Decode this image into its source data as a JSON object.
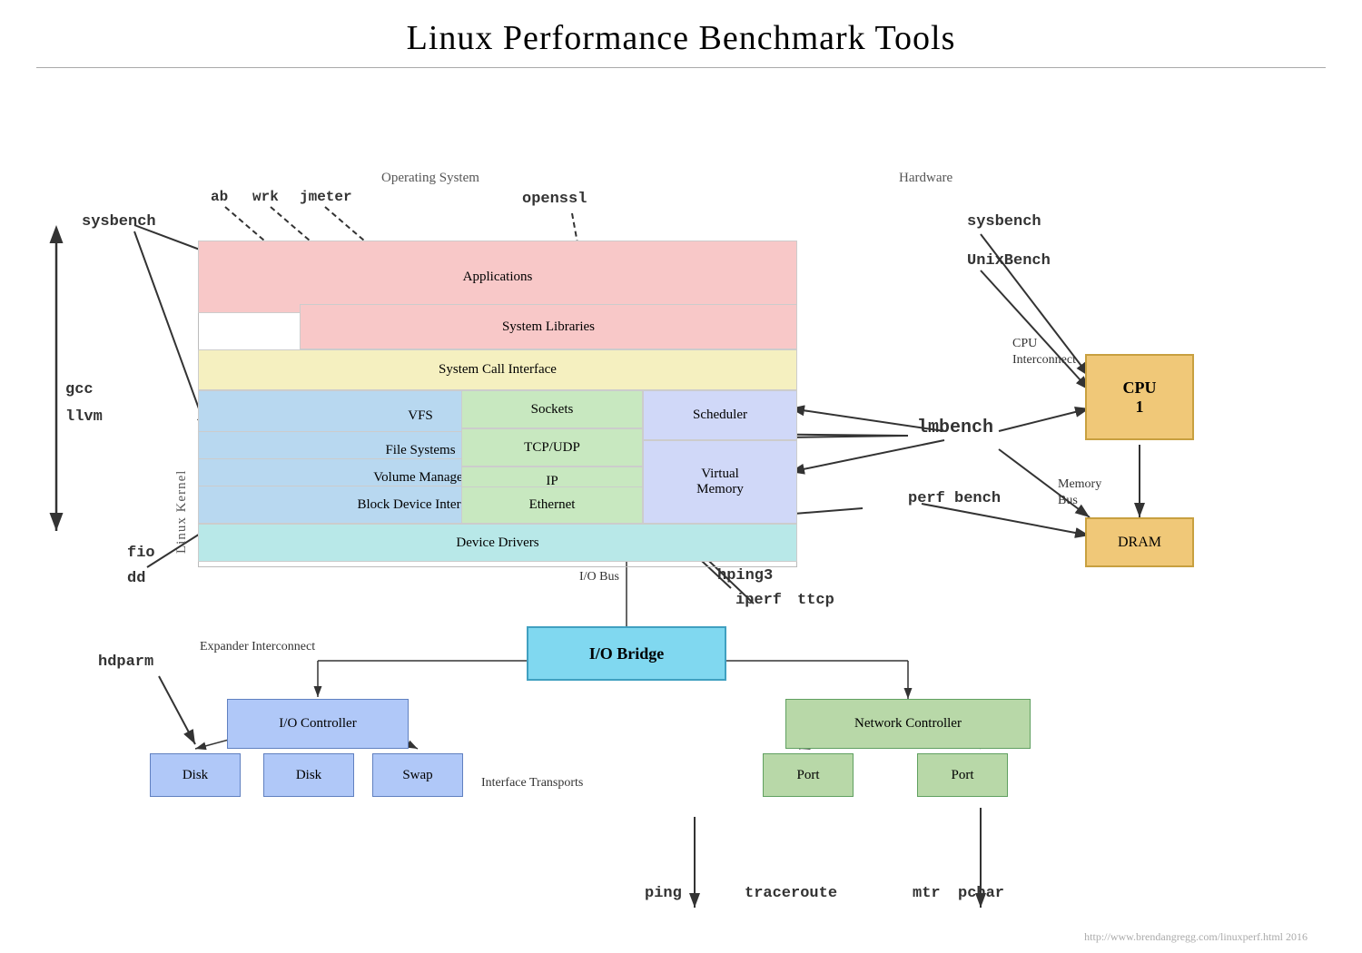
{
  "title": "Linux Performance Benchmark Tools",
  "url": "http://www.brendangregg.com/linuxperf.html 2016",
  "sections": {
    "os_label": "Operating System",
    "hw_label": "Hardware",
    "kernel_label": "Linux Kernel",
    "cpu_interconnect": "CPU\nInterconnect",
    "memory_bus": "Memory\nBus",
    "io_bus": "I/O Bus",
    "expander_interconnect": "Expander Interconnect",
    "interface_transports": "Interface Transports"
  },
  "layers": {
    "applications": "Applications",
    "system_libraries": "System Libraries",
    "system_call_interface": "System Call Interface",
    "vfs": "VFS",
    "file_systems": "File Systems",
    "volume_manager": "Volume Manager",
    "block_device_interface": "Block Device Interface",
    "sockets": "Sockets",
    "tcp_udp": "TCP/UDP",
    "ip": "IP",
    "ethernet": "Ethernet",
    "scheduler": "Scheduler",
    "virtual_memory": "Virtual\nMemory",
    "device_drivers": "Device Drivers"
  },
  "hardware": {
    "cpu": "CPU\n1",
    "dram": "DRAM",
    "io_bridge": "I/O Bridge",
    "io_controller": "I/O Controller",
    "disk1": "Disk",
    "disk2": "Disk",
    "swap": "Swap",
    "network_controller": "Network Controller",
    "port1": "Port",
    "port2": "Port"
  },
  "tools": {
    "sysbench_left": "sysbench",
    "ab": "ab",
    "wrk": "wrk",
    "jmeter": "jmeter",
    "openssl": "openssl",
    "gcc": "gcc",
    "llvm": "llvm",
    "fio": "fio",
    "dd": "dd",
    "hdparm": "hdparm",
    "sysbench_right": "sysbench",
    "unixbench": "UnixBench",
    "lmbench": "lmbench",
    "perf_bench": "perf bench",
    "hping3": "hping3",
    "iperf": "iperf",
    "ttcp": "ttcp",
    "ping": "ping",
    "traceroute": "traceroute",
    "mtr": "mtr",
    "pchar": "pchar"
  }
}
